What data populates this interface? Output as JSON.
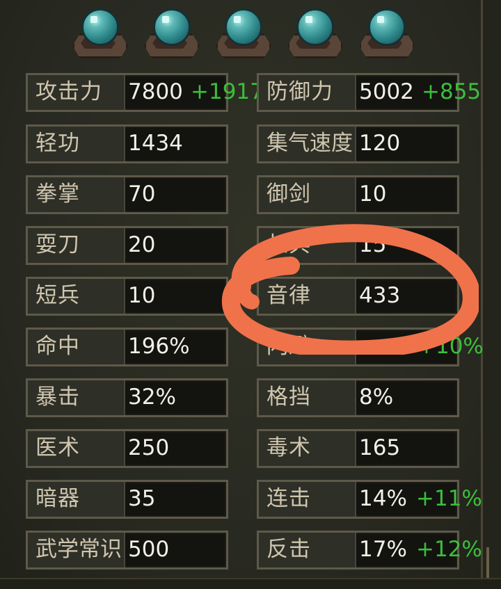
{
  "orbs": {
    "count": 5,
    "icon": "teal-orb-icon"
  },
  "stats": {
    "left": [
      {
        "label": "攻击力",
        "value": "7800",
        "bonus": "+1917"
      },
      {
        "label": "轻功",
        "value": "1434",
        "bonus": ""
      },
      {
        "label": "拳掌",
        "value": "70",
        "bonus": ""
      },
      {
        "label": "耍刀",
        "value": "20",
        "bonus": ""
      },
      {
        "label": "短兵",
        "value": "10",
        "bonus": ""
      },
      {
        "label": "命中",
        "value": "196%",
        "bonus": ""
      },
      {
        "label": "暴击",
        "value": "32%",
        "bonus": ""
      },
      {
        "label": "医术",
        "value": "250",
        "bonus": ""
      },
      {
        "label": "暗器",
        "value": "35",
        "bonus": ""
      },
      {
        "label": "武学常识",
        "value": "500",
        "bonus": ""
      }
    ],
    "right": [
      {
        "label": "防御力",
        "value": "5002",
        "bonus": "+855"
      },
      {
        "label": "集气速度",
        "value": "120",
        "bonus": ""
      },
      {
        "label": "御剑",
        "value": "10",
        "bonus": ""
      },
      {
        "label": "长兵",
        "value": "15",
        "bonus": ""
      },
      {
        "label": "音律",
        "value": "433",
        "bonus": ""
      },
      {
        "label": "闪避",
        "value": "",
        "bonus": "+10%"
      },
      {
        "label": "格挡",
        "value": "8%",
        "bonus": ""
      },
      {
        "label": "毒术",
        "value": "165",
        "bonus": ""
      },
      {
        "label": "连击",
        "value": "14%",
        "bonus": "+11%"
      },
      {
        "label": "反击",
        "value": "17%",
        "bonus": "+12%"
      }
    ]
  },
  "colors": {
    "bonus_green": "#3bbf3b",
    "highlight_orange": "#f0724a",
    "label_text": "#cfc6b0",
    "value_text": "#f2f0e8"
  }
}
